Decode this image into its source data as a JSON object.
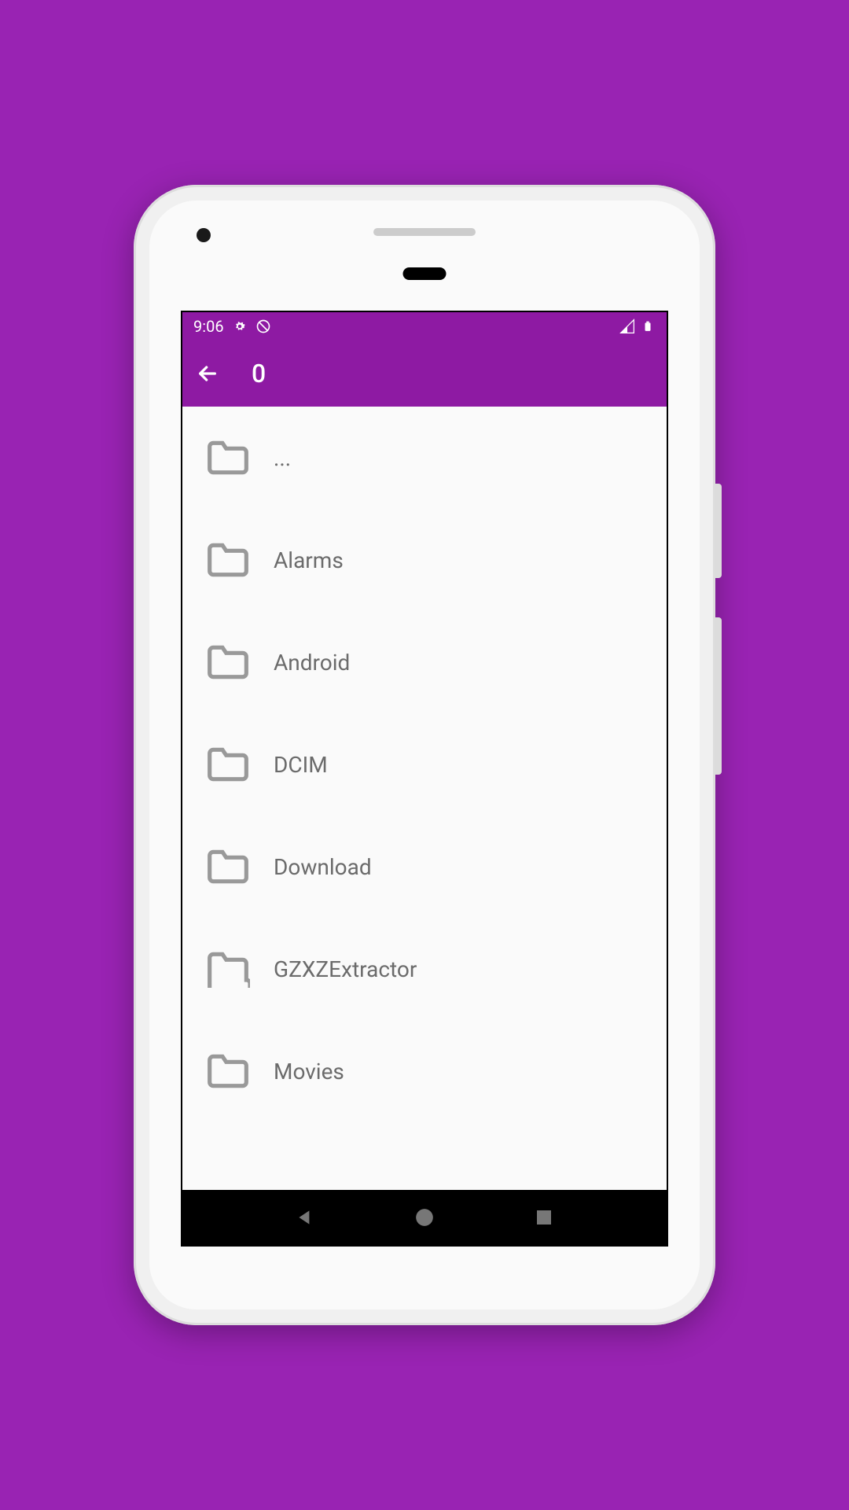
{
  "status": {
    "time": "9:06"
  },
  "header": {
    "title": "0"
  },
  "files": [
    {
      "name": "..."
    },
    {
      "name": "Alarms"
    },
    {
      "name": "Android"
    },
    {
      "name": "DCIM"
    },
    {
      "name": "Download"
    },
    {
      "name": "GZXZExtractor"
    },
    {
      "name": "Movies"
    }
  ]
}
